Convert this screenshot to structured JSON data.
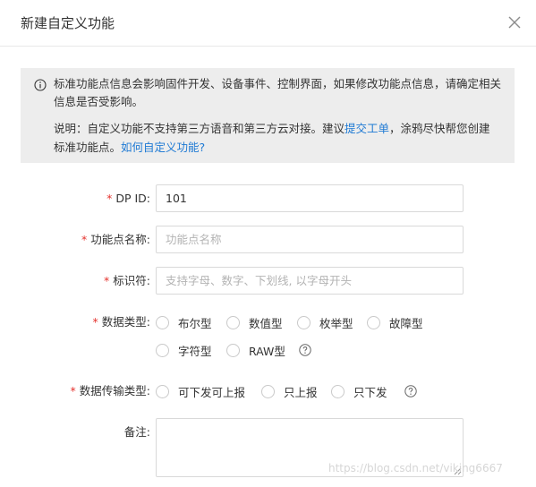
{
  "dialog": {
    "title": "新建自定义功能"
  },
  "notice": {
    "line1": "标准功能点信息会影响固件开发、设备事件、控制界面，如果修改功能点信息，请确定相关信息是否受影响。",
    "line2_prefix": "说明：自定义功能不支持第三方语音和第三方云对接。建议",
    "link1": "提交工单",
    "line2_middle": "，涂鸦尽快帮您创建标准功能点。",
    "link2": "如何自定义功能?"
  },
  "form": {
    "required_mark": "*",
    "dpid": {
      "label": "DP ID:",
      "value": "101"
    },
    "name": {
      "label": "功能点名称:",
      "placeholder": "功能点名称"
    },
    "identifier": {
      "label": "标识符:",
      "placeholder": "支持字母、数字、下划线, 以字母开头"
    },
    "data_type": {
      "label": "数据类型:",
      "options": [
        "布尔型",
        "数值型",
        "枚举型",
        "故障型",
        "字符型",
        "RAW型"
      ]
    },
    "transfer_type": {
      "label": "数据传输类型:",
      "options": [
        "可下发可上报",
        "只上报",
        "只下发"
      ]
    },
    "remark": {
      "label": "备注:"
    }
  },
  "watermark": "https://blog.csdn.net/viking6667",
  "colors": {
    "link": "#1f7ad4",
    "required": "#e5322d",
    "notice_bg": "#ededed",
    "border": "#d9d9d9"
  }
}
